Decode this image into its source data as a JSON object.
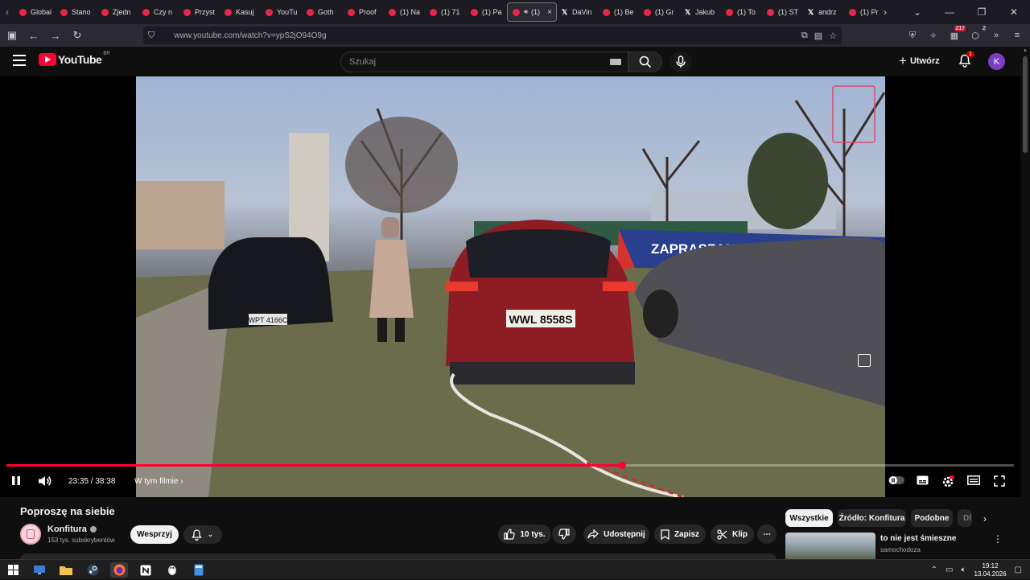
{
  "browser": {
    "tabs": [
      {
        "label": "Global",
        "icon": "youtube-icon"
      },
      {
        "label": "Stano",
        "icon": "youtube-icon"
      },
      {
        "label": "Zjedn",
        "icon": "youtube-icon"
      },
      {
        "label": "Czy n",
        "icon": "youtube-icon"
      },
      {
        "label": "Przyst",
        "icon": "youtube-icon"
      },
      {
        "label": "Kasuj",
        "icon": "youtube-icon"
      },
      {
        "label": "YouTu",
        "icon": "youtube-icon"
      },
      {
        "label": "Goth",
        "icon": "youtube-icon"
      },
      {
        "label": "Proof",
        "icon": "youtube-icon"
      },
      {
        "label": "(1) Na",
        "icon": "youtube-icon"
      },
      {
        "label": "(1) 71",
        "icon": "youtube-icon"
      },
      {
        "label": "(1) Pa",
        "icon": "youtube-icon"
      },
      {
        "label": "(1)",
        "icon": "youtube-icon",
        "active": true,
        "close": "×"
      },
      {
        "label": "DaVin",
        "icon": "x-icon"
      },
      {
        "label": "(1) Be",
        "icon": "youtube-icon"
      },
      {
        "label": "(1) Gr",
        "icon": "youtube-icon"
      },
      {
        "label": "Jakub",
        "icon": "x-icon"
      },
      {
        "label": "(1) To",
        "icon": "youtube-icon"
      },
      {
        "label": "(1) ST",
        "icon": "youtube-icon"
      },
      {
        "label": "andrz",
        "icon": "x-icon"
      },
      {
        "label": "(1) Pr",
        "icon": "youtube-icon"
      }
    ],
    "url": "www.youtube.com/watch?v=ypS2jO94O9g",
    "ext_counts": {
      "a": "217",
      "b": "2"
    }
  },
  "youtube": {
    "logo_text": "YouTube",
    "country_code": "BR",
    "search_placeholder": "Szukaj",
    "create_label": "Utwórz",
    "notifications_count": "1",
    "avatar_letter": "K"
  },
  "scene": {
    "banner_text": "ZAPRASZAMY",
    "plate_text": "WWL 8558S",
    "plate_left": "WPT 4166C"
  },
  "player": {
    "time_current": "23:35",
    "time_total": "38:38",
    "time_display": "23:35 / 38:38",
    "chapter_label": "W tym filmie",
    "progress": 0.611
  },
  "video": {
    "title": "Poproszę na siebie",
    "channel": "Konfitura",
    "subscribers": "153 tys. subskrybentów",
    "support_label": "Wesprzyj",
    "likes_label": "10 tys.",
    "share_label": "Udostępnij",
    "save_label": "Zapisz",
    "clip_label": "Klip"
  },
  "chips": [
    {
      "label": "Wszystkie",
      "active": true
    },
    {
      "label": "Źródło: Konfitura"
    },
    {
      "label": "Podobne"
    },
    {
      "label": "Dl"
    }
  ],
  "recommendation": {
    "title": "to nie jest śmieszne",
    "channel": "samochodoza"
  },
  "taskbar": {
    "time": "19:12",
    "date": "13.04.2026"
  },
  "colors": {
    "accent": "#ff0033",
    "background": "#0f0f0f"
  }
}
